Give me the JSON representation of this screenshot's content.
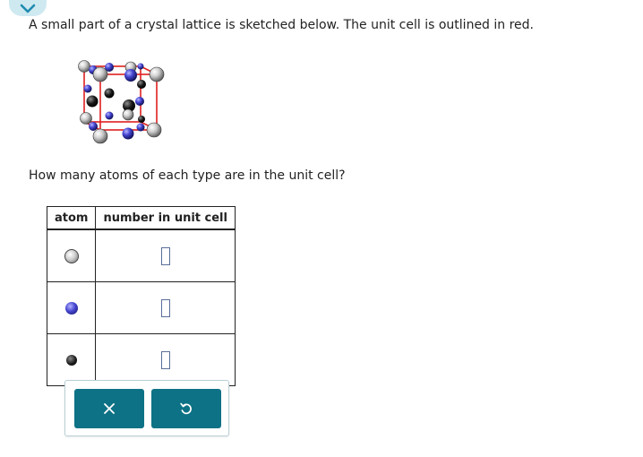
{
  "prompt_text": "A small part of a crystal lattice is sketched below. The unit cell is outlined in red.",
  "question_text": "How many atoms of each type are in the unit cell?",
  "table": {
    "headers": [
      "atom",
      "number in unit cell"
    ],
    "rows": [
      {
        "atom_icon": "gray-atom-icon",
        "atom_color": "#c8c8c8",
        "value": ""
      },
      {
        "atom_icon": "blue-atom-icon",
        "atom_color": "#3a3acc",
        "value": ""
      },
      {
        "atom_icon": "black-atom-icon",
        "atom_color": "#111111",
        "value": ""
      }
    ]
  },
  "icons": {
    "collapse": "chevron-down-icon",
    "clear": "x-icon",
    "reset": "undo-icon",
    "lattice": "crystal-lattice-image"
  },
  "colors": {
    "button": "#0e7286",
    "tab": "#cfe9f1",
    "unit_cell_outline": "#e02020"
  }
}
